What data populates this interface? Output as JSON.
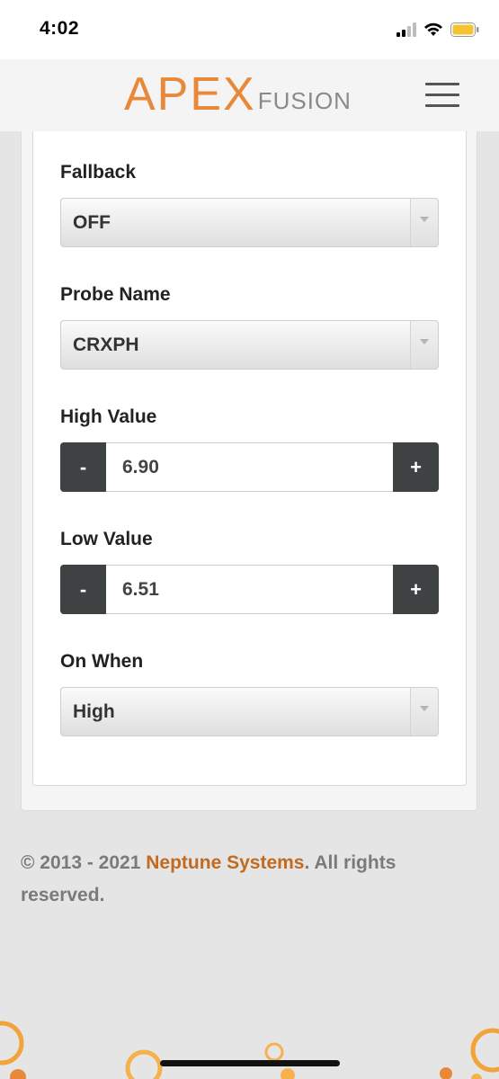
{
  "status_bar": {
    "time": "4:02"
  },
  "header": {
    "logo_primary": "APEX",
    "logo_secondary": "FUSION"
  },
  "form": {
    "fallback": {
      "label": "Fallback",
      "value": "OFF"
    },
    "probe_name": {
      "label": "Probe Name",
      "value": "CRXPH"
    },
    "high_value": {
      "label": "High Value",
      "value": "6.90",
      "minus": "-",
      "plus": "+"
    },
    "low_value": {
      "label": "Low Value",
      "value": "6.51",
      "minus": "-",
      "plus": "+"
    },
    "on_when": {
      "label": "On When",
      "value": "High"
    }
  },
  "footer": {
    "copyright_prefix": "© 2013 - 2021 ",
    "company_link": "Neptune Systems",
    "copyright_suffix": ". All rights reserved."
  },
  "colors": {
    "accent": "#e8893a",
    "link": "#c26a1f",
    "stepper_button": "#3f4242"
  }
}
